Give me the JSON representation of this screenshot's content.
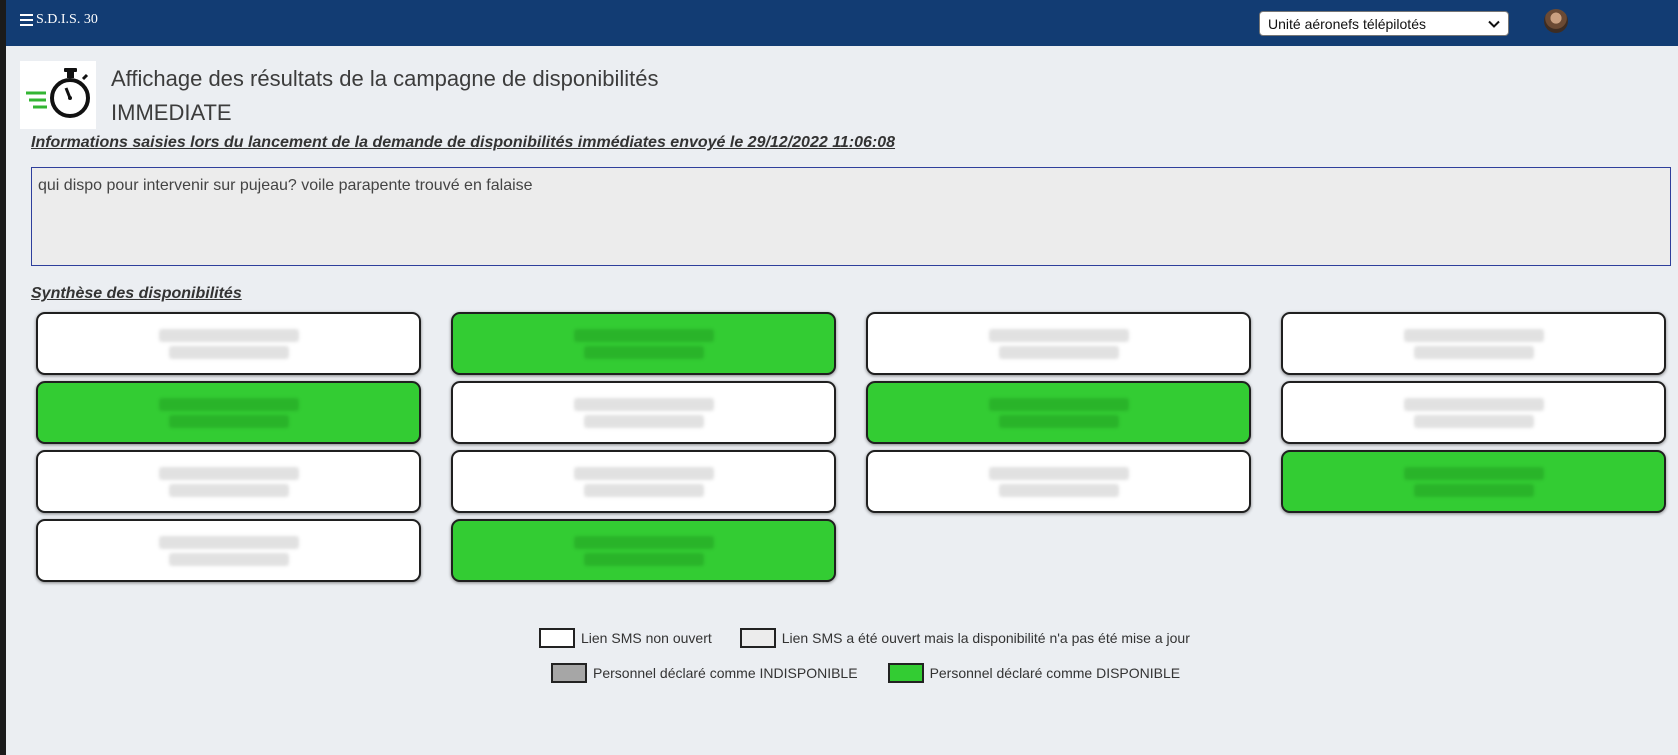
{
  "header": {
    "brand": "S.D.I.S. 30",
    "unit_select": {
      "selected": "Unité aéronefs télépilotés"
    },
    "user_name": ""
  },
  "page": {
    "title": "Affichage des résultats de la campagne de disponibilités",
    "subtitle": "IMMEDIATE",
    "info_heading": "Informations saisies lors du lancement de la demande de disponibilités immédiates envoyé le 29/12/2022 11:06:08",
    "message": "qui dispo pour intervenir sur pujeau? voile parapente trouvé en falaise",
    "synthesis_heading": "Synthèse des disponibilités"
  },
  "personnel": [
    {
      "name": "",
      "phone": "",
      "status": "sms_not_opened"
    },
    {
      "name": "",
      "phone": "",
      "status": "available"
    },
    {
      "name": "",
      "phone": "",
      "status": "sms_not_opened"
    },
    {
      "name": "",
      "phone": "",
      "status": "sms_not_opened"
    },
    {
      "name": "",
      "phone": "",
      "status": "available"
    },
    {
      "name": "",
      "phone": "",
      "status": "sms_not_opened"
    },
    {
      "name": "",
      "phone": "",
      "status": "available"
    },
    {
      "name": "",
      "phone": "",
      "status": "sms_not_opened"
    },
    {
      "name": "",
      "phone": "",
      "status": "sms_not_opened"
    },
    {
      "name": "",
      "phone": "",
      "status": "sms_not_opened"
    },
    {
      "name": "",
      "phone": "",
      "status": "sms_not_opened"
    },
    {
      "name": "",
      "phone": "",
      "status": "available"
    },
    {
      "name": "",
      "phone": "",
      "status": "sms_not_opened"
    },
    {
      "name": "",
      "phone": "",
      "status": "available"
    }
  ],
  "legend": {
    "sms_not_opened": "Lien SMS non ouvert",
    "sms_opened_not_updated": "Lien SMS a été ouvert mais la disponibilité n'a pas été mise a jour",
    "unavailable": "Personnel déclaré comme INDISPONIBLE",
    "available": "Personnel déclaré comme DISPONIBLE"
  },
  "colors": {
    "navbar": "#123c73",
    "background": "#ebeef2",
    "available": "#33cc33",
    "unavailable": "#a6a6a6",
    "sms_not_opened": "#ffffff",
    "sms_opened_not_updated": "#ececec",
    "message_border": "#2e3f9c"
  },
  "icons": {
    "menu": "hamburger-menu-icon",
    "logo": "stopwatch-icon",
    "select_arrow": "chevron-down-icon",
    "avatar": "user-avatar"
  }
}
